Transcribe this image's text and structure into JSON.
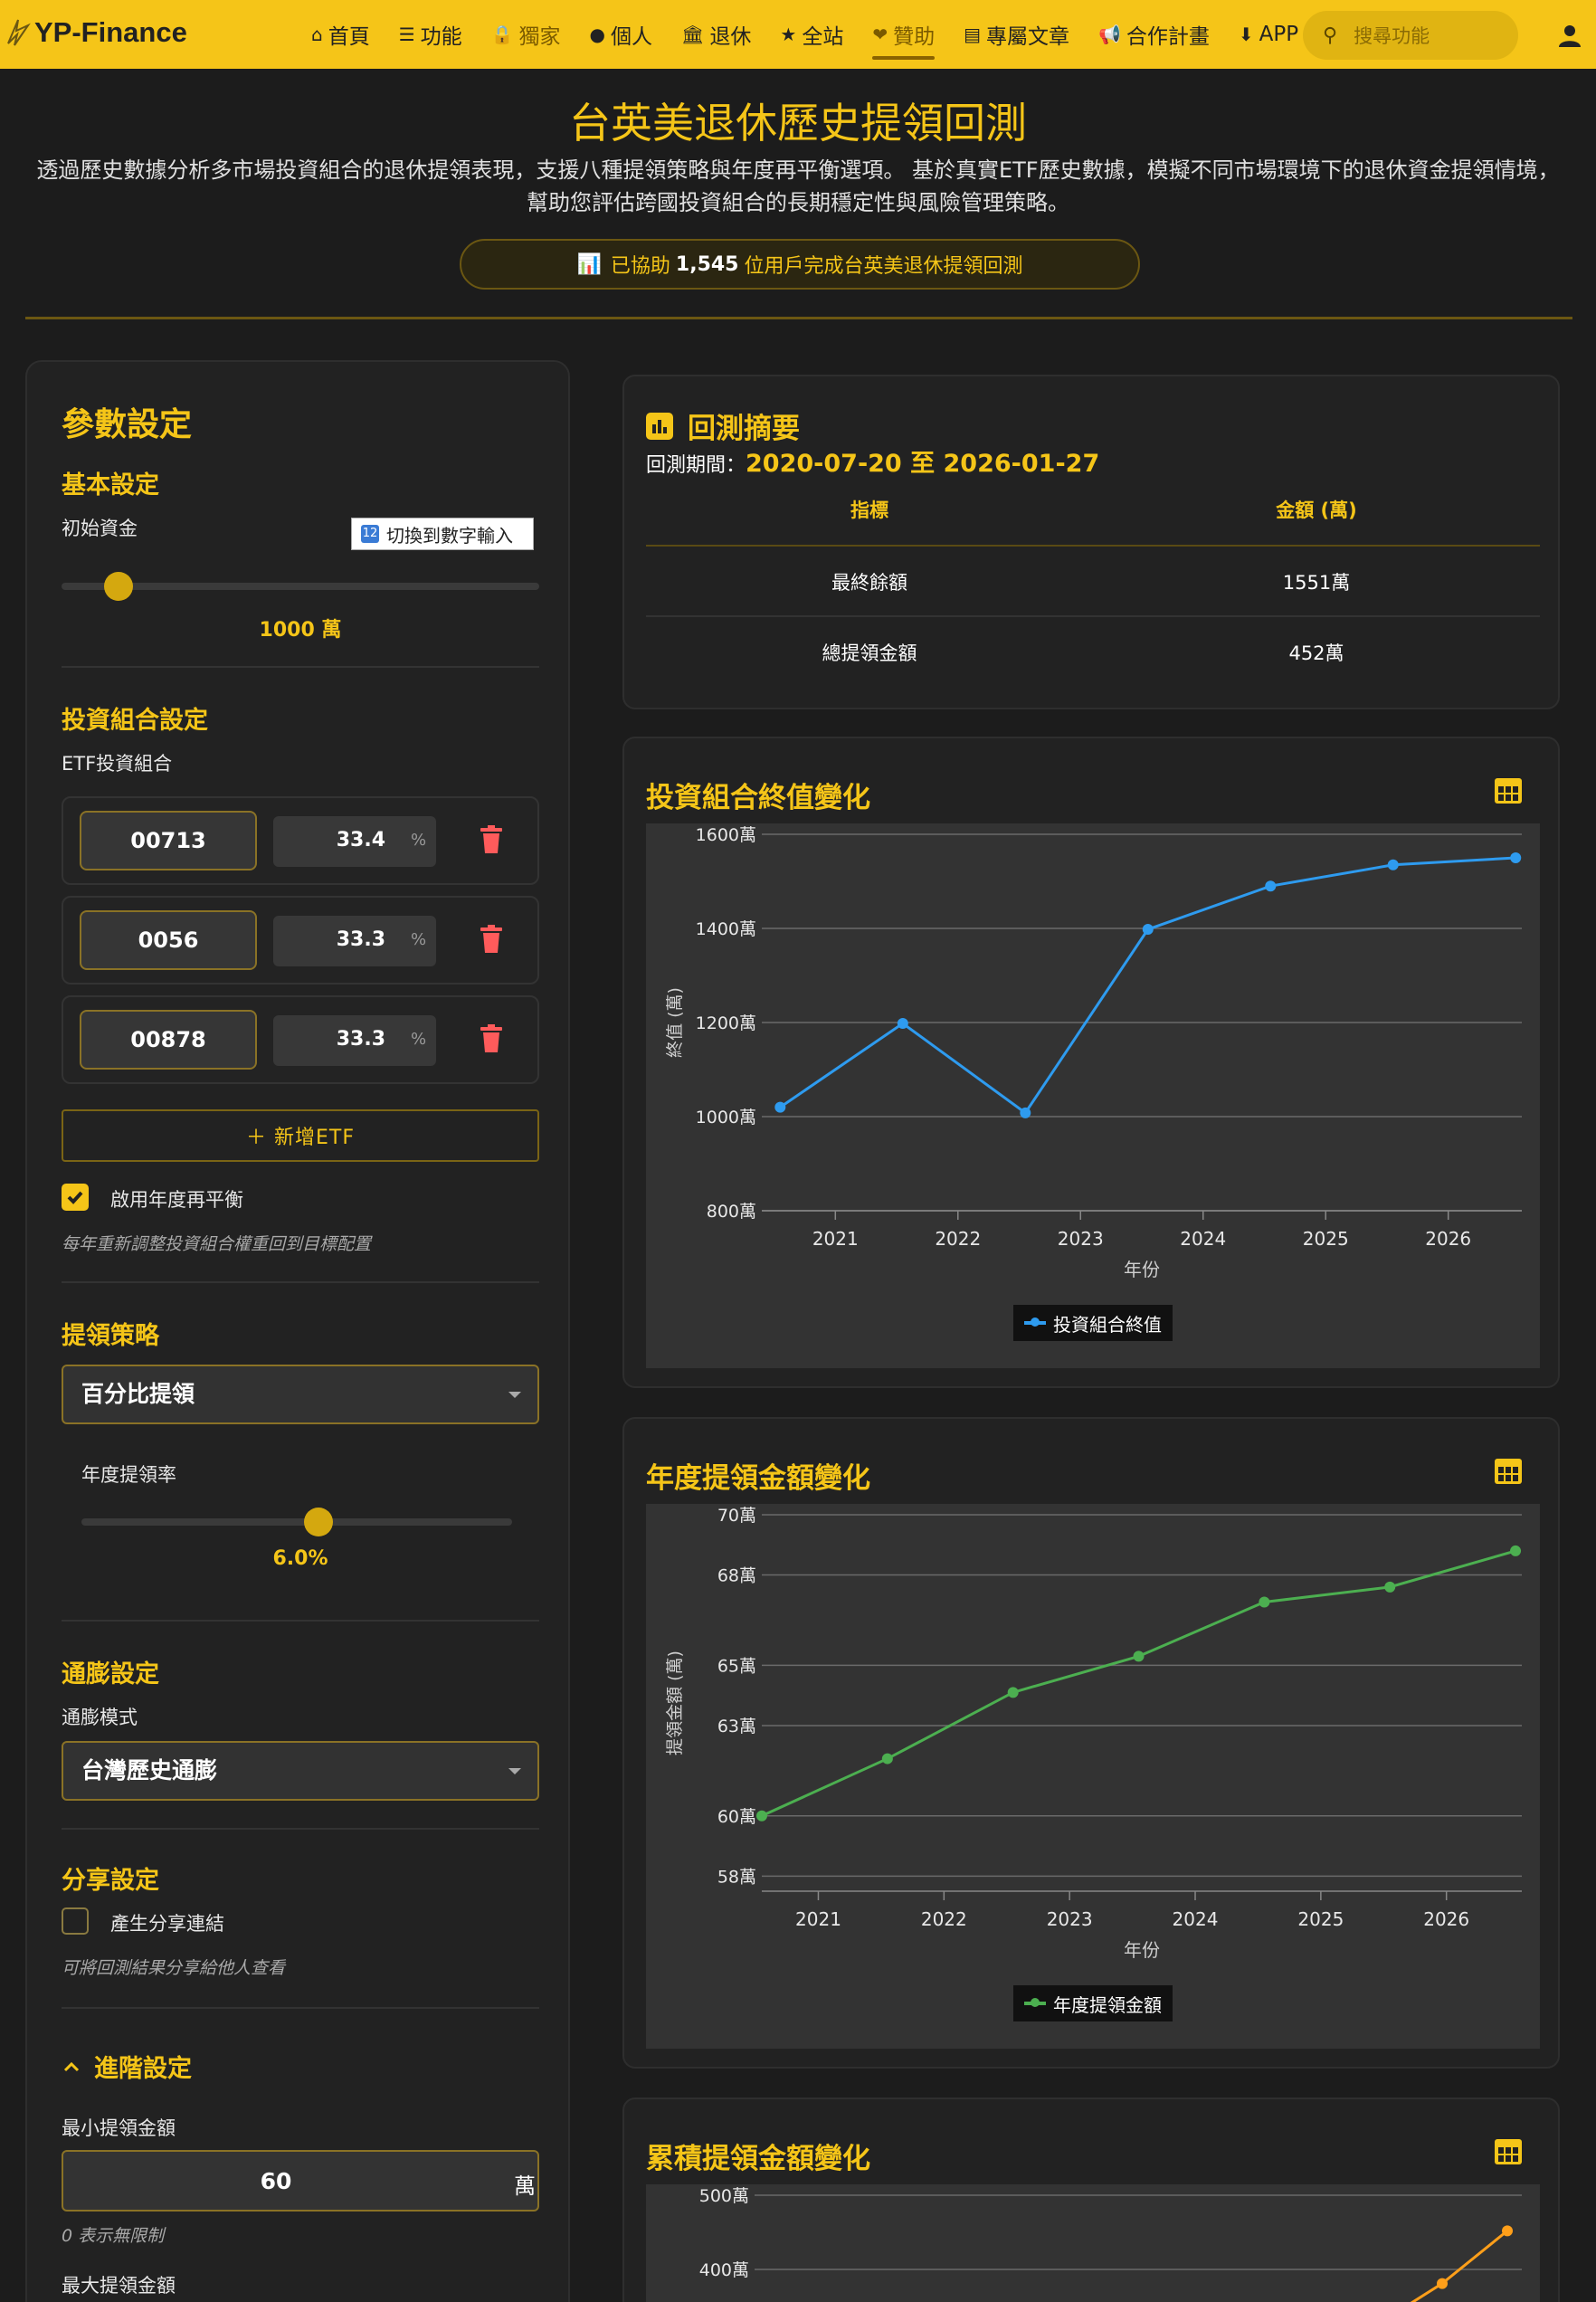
{
  "nav": {
    "brand": "YP-Finance",
    "items": [
      {
        "icon": "home-icon",
        "glyph": "⌂",
        "label": "首頁",
        "active": false
      },
      {
        "icon": "list-icon",
        "glyph": "☰",
        "label": "功能",
        "active": false
      },
      {
        "icon": "lock-icon",
        "glyph": "🔒",
        "label": "獨家",
        "active": true
      },
      {
        "icon": "person-icon",
        "glyph": "●",
        "label": "個人",
        "active": false
      },
      {
        "icon": "bank-icon",
        "glyph": "🏛",
        "label": "退休",
        "active": false
      },
      {
        "icon": "star-icon",
        "glyph": "★",
        "label": "全站",
        "active": false
      },
      {
        "icon": "donate-icon",
        "glyph": "❤",
        "label": "贊助",
        "active": true
      },
      {
        "icon": "article-icon",
        "glyph": "▤",
        "label": "專屬文章",
        "active": false
      },
      {
        "icon": "megaphone-icon",
        "glyph": "📢",
        "label": "合作計畫",
        "active": false
      },
      {
        "icon": "download-icon",
        "glyph": "⬇",
        "label": "APP",
        "active": false
      }
    ],
    "search_placeholder": "搜尋功能"
  },
  "hero": {
    "title": "台英美退休歷史提領回測",
    "desc_line1": "透過歷史數據分析多市場投資組合的退休提領表現，支援八種提領策略與年度再平衡選項。 基於真實ETF歷史數據，模擬不同市場環境下的退休資金提領情境，",
    "desc_line2": "幫助您評估跨國投資組合的長期穩定性與風險管理策略。",
    "users_prefix": "已協助",
    "users_count": "1,545",
    "users_suffix": "位用戶完成台英美退休提領回測"
  },
  "params": {
    "title": "參數設定",
    "basic_title": "基本設定",
    "initial_label": "初始資金",
    "toggle_label": "切換到數字輸入",
    "initial_value": "1000 萬",
    "initial_slider_fraction": 0.12,
    "portfolio_title": "投資組合設定",
    "etf_label": "ETF投資組合",
    "etfs": [
      {
        "code": "00713",
        "pct": "33.4",
        "unit": "%"
      },
      {
        "code": "0056",
        "pct": "33.3",
        "unit": "%"
      },
      {
        "code": "00878",
        "pct": "33.3",
        "unit": "%"
      }
    ],
    "add_etf": "＋ 新增ETF",
    "rebalance_label": "啟用年度再平衡",
    "rebalance_checked": true,
    "rebalance_hint": "每年重新調整投資組合權重回到目標配置",
    "strategy_title": "提領策略",
    "strategy_value": "百分比提領",
    "rate_label": "年度提領率",
    "rate_value": "6.0%",
    "rate_slider_fraction": 0.55,
    "inflation_title": "通膨設定",
    "inflation_mode_label": "通膨模式",
    "inflation_value": "台灣歷史通膨",
    "share_title": "分享設定",
    "share_label": "產生分享連結",
    "share_checked": false,
    "share_hint": "可將回測結果分享給他人查看",
    "advanced_title": "進階設定",
    "min_label": "最小提領金額",
    "min_value": "60",
    "min_unit": "萬",
    "min_hint": "0 表示無限制",
    "max_label": "最大提領金額"
  },
  "summary": {
    "title": "回測摘要",
    "period_label": "回測期間：",
    "period_value": "2020-07-20 至 2026-01-27",
    "col_metric": "指標",
    "col_amount": "金額 (萬)",
    "rows": [
      {
        "metric": "最終餘額",
        "amount": "1551萬"
      },
      {
        "metric": "總提領金額",
        "amount": "452萬"
      }
    ]
  },
  "colors": {
    "gold": "#f5c518",
    "blue": "#2e9bef",
    "green": "#4caf50",
    "orange": "#ff9f1a"
  },
  "chart_data": [
    {
      "type": "line",
      "title": "投資組合終值變化",
      "xlabel": "年份",
      "ylabel": "終值 (萬)",
      "x": [
        2020.55,
        2021.55,
        2022.55,
        2023.55,
        2024.55,
        2025.55,
        2026.55
      ],
      "x_ticks": [
        2021,
        2022,
        2023,
        2024,
        2025,
        2026
      ],
      "xlim": [
        2020.4,
        2026.6
      ],
      "y_ticks": [
        800,
        1000,
        1200,
        1400,
        1600
      ],
      "y_tick_labels": [
        "800萬",
        "1000萬",
        "1200萬",
        "1400萬",
        "1600萬"
      ],
      "ylim": [
        800,
        1600
      ],
      "series": [
        {
          "name": "投資組合終值",
          "color": "#2e9bef",
          "values": [
            1020,
            1198,
            1008,
            1398,
            1490,
            1535,
            1550
          ]
        }
      ],
      "grid": true,
      "legend": "bottom-center"
    },
    {
      "type": "line",
      "title": "年度提領金額變化",
      "xlabel": "年份",
      "ylabel": "提領金額 (萬)",
      "x": [
        2020.55,
        2021.55,
        2022.55,
        2023.55,
        2024.55,
        2025.55,
        2026.55
      ],
      "x_ticks": [
        2021,
        2022,
        2023,
        2024,
        2025,
        2026
      ],
      "xlim": [
        2020.55,
        2026.6
      ],
      "y_ticks": [
        58,
        60,
        63,
        65,
        68,
        70
      ],
      "y_tick_labels": [
        "58萬",
        "60萬",
        "63萬",
        "65萬",
        "68萬",
        "70萬"
      ],
      "ylim": [
        57.5,
        70
      ],
      "series": [
        {
          "name": "年度提領金額",
          "color": "#4caf50",
          "values": [
            60.0,
            61.9,
            64.1,
            65.3,
            67.1,
            67.6,
            68.8
          ]
        }
      ],
      "grid": true,
      "legend": "bottom-center"
    },
    {
      "type": "line",
      "title": "累積提領金額變化",
      "y_ticks": [
        400,
        500
      ],
      "y_tick_labels": [
        "400萬",
        "500萬"
      ],
      "ylim": [
        400,
        500
      ],
      "series": [
        {
          "name": "",
          "color": "#ff9f1a",
          "values": [
            381,
            452
          ]
        }
      ],
      "grid": true
    }
  ]
}
